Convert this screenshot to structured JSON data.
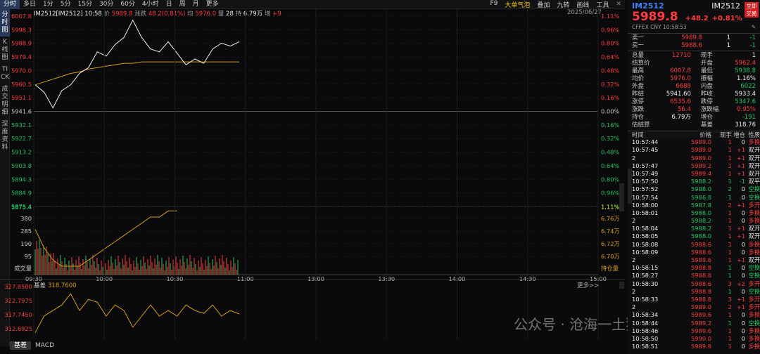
{
  "toolbar": {
    "tabs": [
      "分时",
      "多日",
      "1分",
      "5分",
      "15分",
      "30分",
      "60分",
      "4小时",
      "日",
      "周",
      "月",
      "更多"
    ],
    "active": 0,
    "right": [
      "F9",
      "大单气泡",
      "叠加",
      "九转",
      "画线",
      "工具"
    ]
  },
  "side_tabs": [
    "分时图",
    "K线图",
    "TICK",
    "成交明细",
    "深度资料"
  ],
  "info": {
    "symbol": "IM2512[IM2512]",
    "time": "10:58",
    "price_label": "价",
    "price": "5989.8",
    "chg_label": "涨跌",
    "chg": "48.2(0.81%)",
    "avg_label": "均",
    "avg": "5976.0",
    "vol_label": "量",
    "vol": "28",
    "oi_label": "持",
    "oi": "6.79万",
    "inc_label": "增",
    "inc": "+9",
    "date": "2025/06/27"
  },
  "price_axis": {
    "left": [
      "6007.8",
      "5998.3",
      "5988.9",
      "5979.4",
      "5970.0",
      "5960.5",
      "5951.1",
      "5941.6",
      "5932.1",
      "5922.7",
      "5913.2",
      "5903.8",
      "5894.3",
      "5884.9",
      "5875.4"
    ],
    "right": [
      "1.11%",
      "0.96%",
      "0.80%",
      "0.64%",
      "0.48%",
      "0.32%",
      "0.16%",
      "0.00%",
      "0.16%",
      "0.32%",
      "0.48%",
      "0.64%",
      "0.80%",
      "0.96%",
      "1.11%"
    ]
  },
  "vol_axis": {
    "left": [
      "380",
      "285",
      "190",
      "95"
    ],
    "right": [
      "6.76万",
      "6.74万",
      "6.72万",
      "6.70万"
    ],
    "left_title": "成交量",
    "right_title": "持仓量"
  },
  "time_axis": [
    "09:30",
    "10:00",
    "10:30",
    "11:00",
    "13:00",
    "13:30",
    "14:00",
    "14:30",
    "15:00"
  ],
  "basis": {
    "label": "基差",
    "value": "318.7600",
    "more": "更多>>",
    "axis": [
      "327.8500",
      "322.7975",
      "317.7450",
      "312.6925"
    ]
  },
  "bottom_tabs": [
    "基差",
    "MACD"
  ],
  "chart_data": {
    "type": "line",
    "x": [
      "09:30",
      "10:00",
      "10:30",
      "11:00",
      "13:00",
      "13:30",
      "14:00",
      "14:30",
      "15:00"
    ],
    "series": [
      {
        "name": "price",
        "values": [
          5960,
          5955,
          5944,
          5956,
          5960,
          5968,
          5972,
          5983,
          5980,
          5988,
          5993,
          6005,
          5993,
          5985,
          5983,
          5990,
          5982,
          5974,
          5978,
          5975,
          5985,
          5989,
          5987,
          5990
        ]
      },
      {
        "name": "avg",
        "values": [
          5960,
          5962,
          5964,
          5966,
          5968,
          5969,
          5971,
          5972,
          5973,
          5974,
          5975,
          5975,
          5976,
          5976,
          5976,
          5976,
          5976,
          5976,
          5976,
          5976,
          5976,
          5976,
          5976,
          5976
        ]
      },
      {
        "name": "basis",
        "values": [
          312,
          318,
          320,
          322,
          326,
          320,
          324,
          323,
          318,
          322,
          320,
          314,
          318,
          322,
          318,
          320,
          318,
          322,
          320,
          319,
          322,
          318,
          320,
          318.76
        ]
      },
      {
        "name": "oi",
        "values": [
          6.76,
          6.73,
          6.71,
          6.7,
          6.7,
          6.7,
          6.71,
          6.72,
          6.73,
          6.74,
          6.75,
          6.76,
          6.77,
          6.78,
          6.78,
          6.79,
          6.79
        ]
      }
    ],
    "ylim": [
      5875.4,
      6007.8
    ]
  },
  "rp": {
    "symbol": "IM2512",
    "price": "5989.8",
    "chg": "+48.2",
    "pct": "+0.81%",
    "code": "IM2512",
    "trade": "立即交易",
    "meta": "CFFEX  CNY  10:58:53",
    "ask": {
      "label": "卖一",
      "price": "5989.8",
      "qty": "1",
      "d": "-1"
    },
    "bid": {
      "label": "买一",
      "price": "5988.6",
      "qty": "1",
      "d": "-1"
    },
    "stats": [
      [
        "总量",
        "12710",
        "现手",
        "1"
      ],
      [
        "结算价",
        "",
        "开盘",
        "5962.4"
      ],
      [
        "最高",
        "6007.8",
        "最低",
        "5938.8"
      ],
      [
        "均价",
        "5976.0",
        "振幅",
        "1.16%"
      ],
      [
        "外盘",
        "6688",
        "内盘",
        "6022"
      ],
      [
        "昨结",
        "5941.60",
        "昨收",
        "5933.4"
      ],
      [
        "涨停",
        "6535.6",
        "跌停",
        "5347.6"
      ],
      [
        "涨跌",
        "56.4",
        "涨跌幅",
        "0.95%"
      ],
      [
        "持仓",
        "6.79万",
        "增仓",
        "-191"
      ],
      [
        "估结算",
        "",
        "基差",
        "318.76"
      ]
    ],
    "thead": [
      "时间",
      "价格",
      "现手",
      "增仓",
      "性质"
    ],
    "trades": [
      [
        "10:57:44",
        "5989.0",
        "1",
        "0",
        "多换"
      ],
      [
        "10:57:45",
        "5989.0",
        "1",
        "+1",
        "双开"
      ],
      [
        "2",
        "5989.0",
        "1",
        "+1",
        "双开"
      ],
      [
        "10:57:47",
        "5989.2",
        "1",
        "+1",
        "双开"
      ],
      [
        "10:57:49",
        "5989.4",
        "1",
        "+1",
        "双开"
      ],
      [
        "10:57:50",
        "5988.2",
        "1",
        "-1",
        "双平"
      ],
      [
        "10:57:52",
        "5988.0",
        "2",
        "0",
        "空换"
      ],
      [
        "10:57:54",
        "5986.8",
        "1",
        "0",
        "空换"
      ],
      [
        "10:58:00",
        "5987.8",
        "2",
        "+1",
        "多开"
      ],
      [
        "10:58:01",
        "5988.0",
        "1",
        "0",
        "多换"
      ],
      [
        "2",
        "5988.2",
        "1",
        "0",
        "多换"
      ],
      [
        "10:58:04",
        "5988.2",
        "1",
        "+1",
        "双开"
      ],
      [
        "10:58:05",
        "5988.0",
        "1",
        "+1",
        "双开"
      ],
      [
        "10:58:08",
        "5988.6",
        "1",
        "0",
        "多换"
      ],
      [
        "10:58:09",
        "5988.6",
        "1",
        "0",
        "多换"
      ],
      [
        "2",
        "5989.6",
        "1",
        "+1",
        "双开"
      ],
      [
        "10:58:15",
        "5988.8",
        "1",
        "0",
        "空换"
      ],
      [
        "10:58:27",
        "5988.8",
        "1",
        "0",
        "空换"
      ],
      [
        "10:58:30",
        "5988.6",
        "3",
        "+2",
        "多开"
      ],
      [
        "2",
        "5988.8",
        "1",
        "0",
        "空换"
      ],
      [
        "10:58:33",
        "5988.8",
        "3",
        "+1",
        "多开"
      ],
      [
        "2",
        "5989.0",
        "2",
        "+1",
        "多开"
      ],
      [
        "10:58:34",
        "5989.6",
        "1",
        "0",
        "多换"
      ],
      [
        "10:58:44",
        "5989.2",
        "1",
        "0",
        "空换"
      ],
      [
        "10:58:46",
        "5989.6",
        "1",
        "0",
        "多换"
      ],
      [
        "10:58:50",
        "5990.0",
        "1",
        "0",
        "多换"
      ],
      [
        "10:58:51",
        "5989.8",
        "1",
        "0",
        "多换"
      ]
    ]
  },
  "watermark": "公众号 · 沧海一土狗"
}
